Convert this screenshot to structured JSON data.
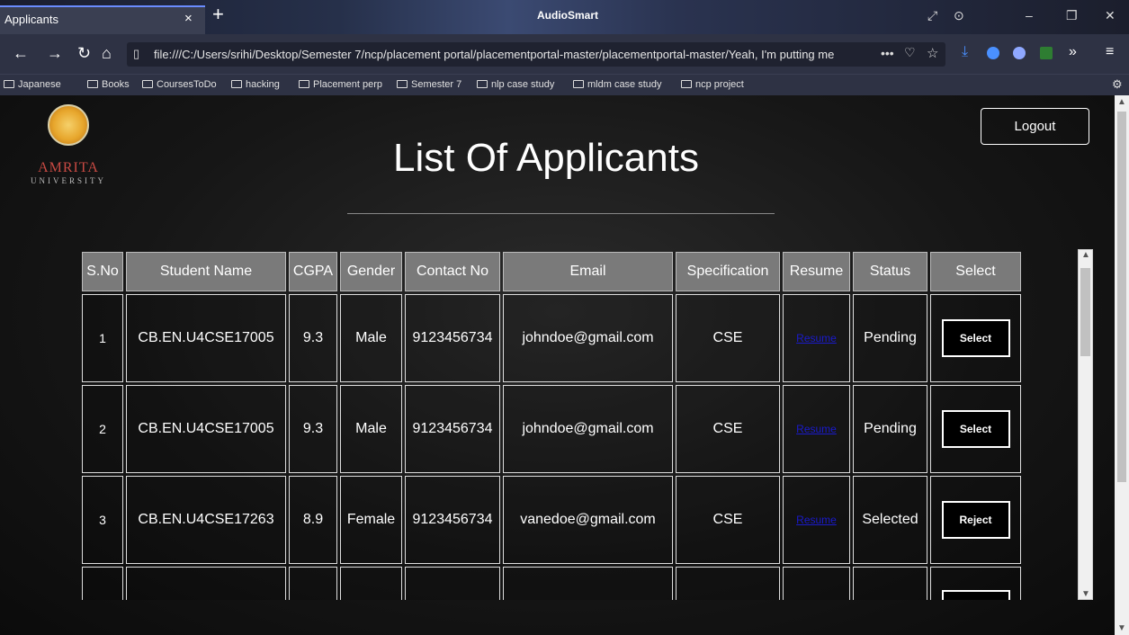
{
  "browser": {
    "tab_title": "Applicants",
    "tab_close": "×",
    "new_tab": "+",
    "app_title": "AudioSmart",
    "url": "file:///C:/Users/srihi/Desktop/Semester 7/ncp/placement portal/placementportal-master/placementportal-master/Yeah, I'm putting me",
    "url_more": "•••",
    "bookmarks": [
      "Japanese",
      "Books",
      "CoursesToDo",
      "hacking",
      "Placement perp",
      "Semester 7",
      "nlp case study",
      "mldm case study",
      "ncp project"
    ],
    "ext_colors": [
      "#4a90ff",
      "#8fa8ff",
      "#2e7d32",
      "#ffd54a"
    ]
  },
  "page": {
    "logo_name": "AMRITA",
    "logo_sub": "UNIVERSITY",
    "title": "List Of Applicants",
    "logout_label": "Logout"
  },
  "table": {
    "headers": [
      "S.No",
      "Student Name",
      "CGPA",
      "Gender",
      "Contact No",
      "Email",
      "Specification",
      "Resume",
      "Status",
      "Select"
    ],
    "rows": [
      {
        "sno": "1",
        "name": "CB.EN.U4CSE17005",
        "cgpa": "9.3",
        "gender": "Male",
        "contact": "9123456734",
        "email": "johndoe@gmail.com",
        "spec": "CSE",
        "resume": "Resume",
        "status": "Pending",
        "action": "Select"
      },
      {
        "sno": "2",
        "name": "CB.EN.U4CSE17005",
        "cgpa": "9.3",
        "gender": "Male",
        "contact": "9123456734",
        "email": "johndoe@gmail.com",
        "spec": "CSE",
        "resume": "Resume",
        "status": "Pending",
        "action": "Select"
      },
      {
        "sno": "3",
        "name": "CB.EN.U4CSE17263",
        "cgpa": "8.9",
        "gender": "Female",
        "contact": "9123456734",
        "email": "vanedoe@gmail.com",
        "spec": "CSE",
        "resume": "Resume",
        "status": "Selected",
        "action": "Reject"
      }
    ]
  }
}
